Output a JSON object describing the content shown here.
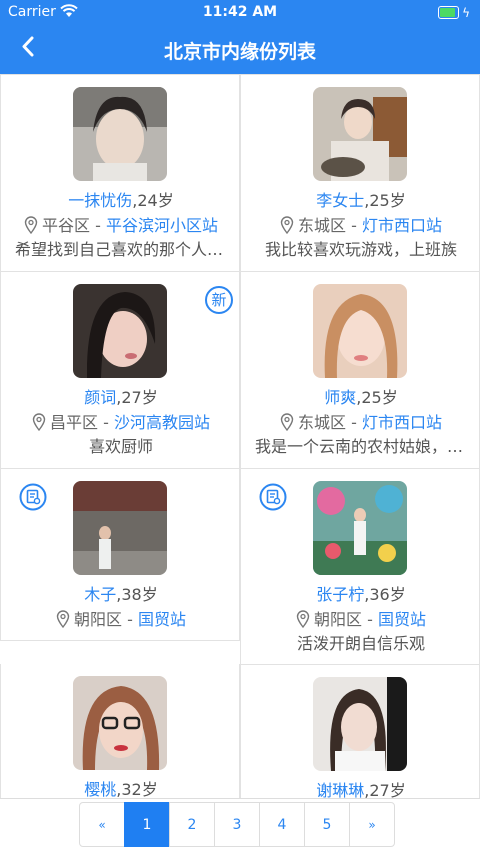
{
  "status_bar": {
    "carrier": "Carrier",
    "time": "11:42 AM",
    "battery_level": 0.85
  },
  "header": {
    "title": "北京市内缘份列表"
  },
  "profiles": [
    {
      "name": "一抹忧伤",
      "age_text": ",24岁",
      "district": "平谷区",
      "sep": " - ",
      "station": "平谷滨河小区站",
      "bio": "希望找到自己喜欢的那个人，一起生活",
      "badge": ""
    },
    {
      "name": "李女士",
      "age_text": ",25岁",
      "district": "东城区",
      "sep": " - ",
      "station": "灯市西口站",
      "bio": "我比较喜欢玩游戏，上班族",
      "badge": ""
    },
    {
      "name": "颜词",
      "age_text": ",27岁",
      "district": "昌平区",
      "sep": " - ",
      "station": "沙河高教园站",
      "bio": "喜欢厨师",
      "badge": "新"
    },
    {
      "name": "师爽",
      "age_text": ",25岁",
      "district": "东城区",
      "sep": " - ",
      "station": "灯市西口站",
      "bio": "我是一个云南的农村姑娘，性格开朗",
      "badge": ""
    },
    {
      "name": "木子",
      "age_text": ",38岁",
      "district": "朝阳区",
      "sep": " - ",
      "station": "国贸站",
      "bio": "",
      "badge": "certificate-icon"
    },
    {
      "name": "张子柠",
      "age_text": ",36岁",
      "district": "朝阳区",
      "sep": " - ",
      "station": "国贸站",
      "bio": "活泼开朗自信乐观",
      "badge": "certificate-icon"
    },
    {
      "name": "樱桃",
      "age_text": ",32岁",
      "district": "",
      "sep": "",
      "station": "",
      "bio": "",
      "badge": ""
    },
    {
      "name": "谢琳琳",
      "age_text": ",27岁",
      "district": "",
      "sep": "",
      "station": "",
      "bio": "",
      "badge": ""
    }
  ],
  "pagination": {
    "prev": "«",
    "pages": [
      "1",
      "2",
      "3",
      "4",
      "5"
    ],
    "next": "»",
    "current": "1"
  },
  "colors": {
    "accent": "#2b86f1",
    "active_page": "#1f7ff2"
  },
  "icons": [
    "back-chevron-icon",
    "wifi-icon",
    "battery-icon",
    "location-pin-icon",
    "new-badge-icon",
    "certificate-icon"
  ]
}
